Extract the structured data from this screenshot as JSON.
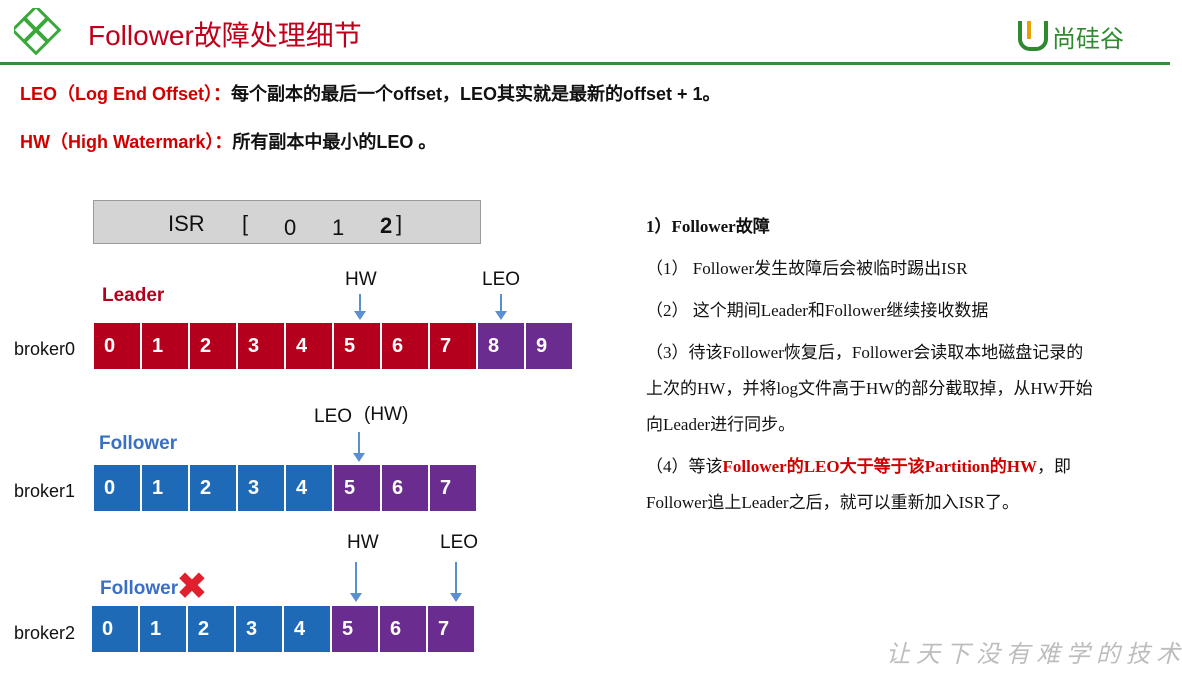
{
  "header": {
    "title": "Follower故障处理细节",
    "logo_text": "尚硅谷"
  },
  "definitions": [
    {
      "key": "LEO（Log End Offset）：",
      "value": "每个副本的最后一个offset，LEO其实就是最新的offset + 1。"
    },
    {
      "key": "HW（High Watermark）：",
      "value": "所有副本中最小的LEO 。"
    }
  ],
  "isr": {
    "label": "ISR",
    "open": "[",
    "ids": [
      "0",
      "1",
      "2"
    ],
    "close": "]"
  },
  "brokers": [
    {
      "name": "broker0",
      "role": "Leader",
      "role_color": "#b4001c",
      "cells": [
        {
          "v": "0",
          "c": "red"
        },
        {
          "v": "1",
          "c": "red"
        },
        {
          "v": "2",
          "c": "red"
        },
        {
          "v": "3",
          "c": "red"
        },
        {
          "v": "4",
          "c": "red"
        },
        {
          "v": "5",
          "c": "red"
        },
        {
          "v": "6",
          "c": "red"
        },
        {
          "v": "7",
          "c": "red"
        },
        {
          "v": "8",
          "c": "purple"
        },
        {
          "v": "9",
          "c": "purple"
        }
      ],
      "markers": [
        "HW",
        "LEO"
      ]
    },
    {
      "name": "broker1",
      "role": "Follower",
      "role_color": "#3a6fc4",
      "cells": [
        {
          "v": "0",
          "c": "blue"
        },
        {
          "v": "1",
          "c": "blue"
        },
        {
          "v": "2",
          "c": "blue"
        },
        {
          "v": "3",
          "c": "blue"
        },
        {
          "v": "4",
          "c": "blue"
        },
        {
          "v": "5",
          "c": "purple"
        },
        {
          "v": "6",
          "c": "purple"
        },
        {
          "v": "7",
          "c": "purple"
        }
      ],
      "markers": [
        "LEO",
        "(HW)"
      ]
    },
    {
      "name": "broker2",
      "role": "Follower",
      "role_color": "#3a6fc4",
      "cells": [
        {
          "v": "0",
          "c": "blue"
        },
        {
          "v": "1",
          "c": "blue"
        },
        {
          "v": "2",
          "c": "blue"
        },
        {
          "v": "3",
          "c": "blue"
        },
        {
          "v": "4",
          "c": "blue"
        },
        {
          "v": "5",
          "c": "purple"
        },
        {
          "v": "6",
          "c": "purple"
        },
        {
          "v": "7",
          "c": "purple"
        }
      ],
      "markers": [
        "HW",
        "LEO"
      ]
    }
  ],
  "colors": {
    "red": "#b4001c",
    "blue": "#1f6ab7",
    "purple": "#6a2c8e",
    "accent": "#d00000"
  },
  "icons": {
    "failure": "x-mark-icon",
    "logo": "logo-icon"
  },
  "explanation": {
    "title": "1）Follower故障",
    "items": [
      "（1） Follower发生故障后会被临时踢出ISR",
      "（2） 这个期间Leader和Follower继续接收数据",
      "（3）待该Follower恢复后，Follower会读取本地磁盘记录的",
      "上次的HW，并将log文件高于HW的部分截取掉，从HW开始",
      "向Leader进行同步。"
    ],
    "item4_pre": "（4）等该",
    "item4_hl": "Follower的LEO大于等于该Partition的HW",
    "item4_post": "，即",
    "item4_line2": "Follower追上Leader之后，就可以重新加入ISR了。"
  },
  "watermark": "让天下没有难学的技术"
}
